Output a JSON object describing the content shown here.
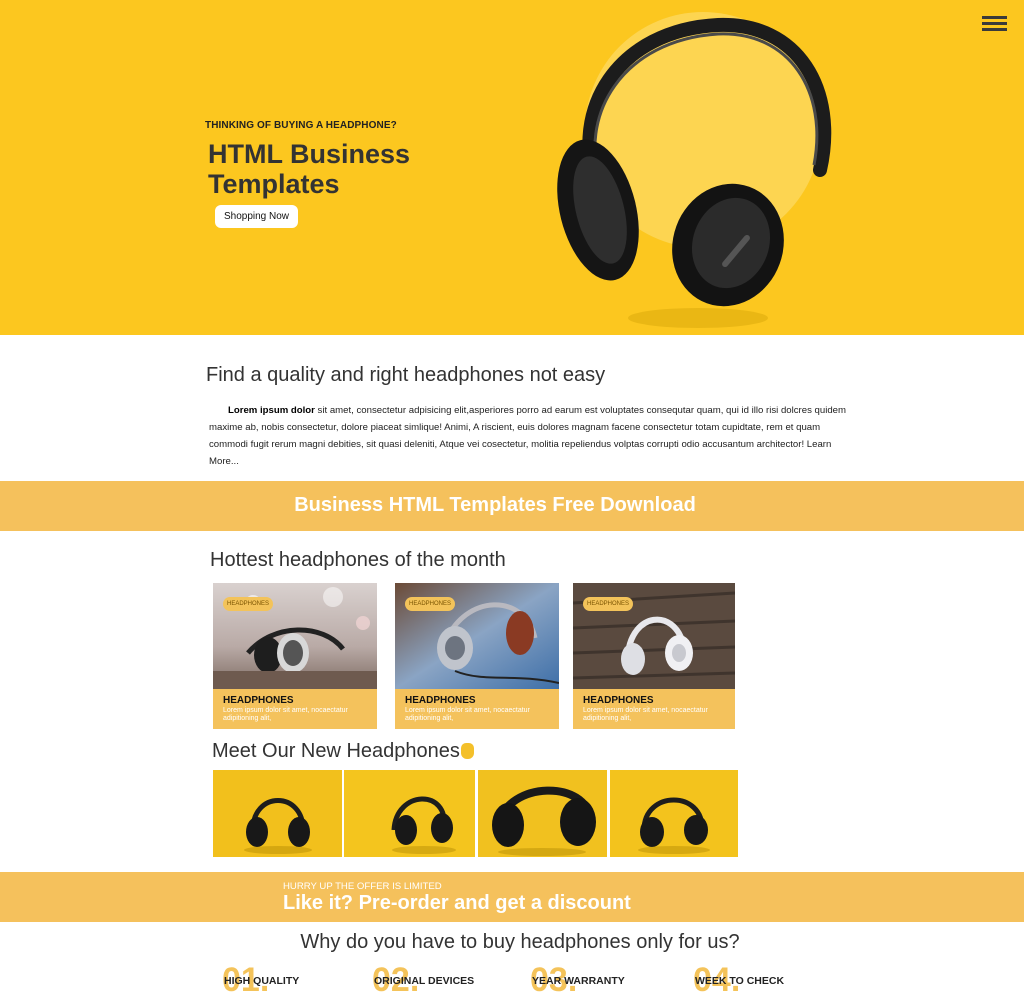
{
  "header": {
    "menu_icon": "hamburger-menu-icon"
  },
  "hero": {
    "kicker": "THINKING OF BUYING A HEADPHONE?",
    "title": "HTML Business Templates",
    "button_label": "Shopping Now",
    "image_icon": "headphones-icon"
  },
  "intro": {
    "title": "Find a quality and right headphones not easy",
    "lead_bold": "Lorem ipsum dolor",
    "body": " sit amet, consectetur adpisicing elit,asperiores porro ad earum est voluptates consequtar quam, qui id illo risi dolcres quidem maxime ab, nobis consectetur, dolore piaceat simlique! Animi, A riscient, euis dolores magnam facene consectetur totam cupidtate, rem et quam commodi fugit rerum magni debities, sit quasi deleniti, Atque vei cosectetur, molitia repeliendus volptas corrupti odio accusantum architector! ",
    "more_link": "Learn More..."
  },
  "banner": {
    "text": "Business HTML Templates Free Download"
  },
  "hottest": {
    "title": "Hottest headphones of the month",
    "cards": [
      {
        "tag": "HEADPHONES",
        "title": "HEADPHONES",
        "text": "Lorem ipsum dolor sit amet, nocaectatur adipitioning alit,"
      },
      {
        "tag": "HEADPHONES",
        "title": "HEADPHONES",
        "text": "Lorem ipsum dolor sit amet, nocaectatur adipitioning alit,"
      },
      {
        "tag": "HEADPHONES",
        "title": "HEADPHONES",
        "text": "Lorem ipsum dolor sit amet, nocaectatur adipitioning alit,"
      }
    ]
  },
  "meet": {
    "title": "Meet Our New Headphones",
    "icon": "hand-icon"
  },
  "offer": {
    "small": "HURRY UP THE OFFER IS LIMITED",
    "big": "Like it? Pre-order and get a discount"
  },
  "why": {
    "title": "Why do you have to buy headphones only for us?",
    "features": [
      {
        "num": "01.",
        "label": "HIGH QUALITY"
      },
      {
        "num": "02.",
        "label": "ORIGINAL DEVICES"
      },
      {
        "num": "03.",
        "label": "YEAR WARRANTY"
      },
      {
        "num": "04.",
        "label": "WEEK TO CHECK"
      }
    ]
  },
  "colors": {
    "accent": "#fcc71f",
    "band": "#f5c15c",
    "text": "#333333"
  }
}
